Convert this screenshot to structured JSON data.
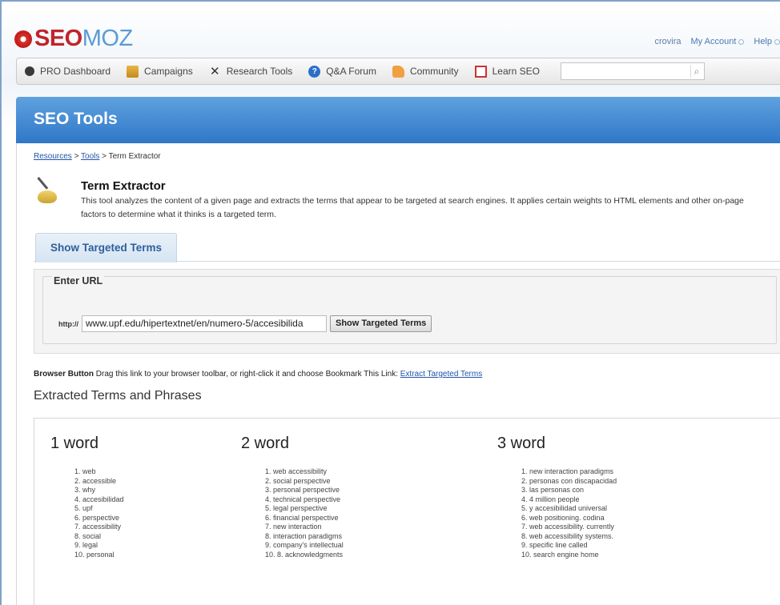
{
  "header": {
    "logo_seo": "SEO",
    "logo_moz": "MOZ",
    "user": "crovira",
    "my_account": "My Account",
    "help": "Help"
  },
  "nav": {
    "items": [
      {
        "label": "PRO Dashboard",
        "icon": "dashboard-icon"
      },
      {
        "label": "Campaigns",
        "icon": "campaigns-icon"
      },
      {
        "label": "Research Tools",
        "icon": "tools-icon"
      },
      {
        "label": "Q&A Forum",
        "icon": "qa-icon"
      },
      {
        "label": "Community",
        "icon": "community-icon"
      },
      {
        "label": "Learn SEO",
        "icon": "learn-icon"
      }
    ],
    "search_value": ""
  },
  "banner": {
    "title": "SEO Tools"
  },
  "breadcrumb": {
    "resources": "Resources",
    "sep1": " > ",
    "tools": "Tools",
    "sep2": " > ",
    "current": "Term Extractor"
  },
  "tool": {
    "title": "Term Extractor",
    "description": "This tool analyzes the content of a given page and extracts the terms that appear to be targeted at search engines. It applies certain weights to HTML elements and other on-page factors to determine what it thinks is a targeted term."
  },
  "tab": {
    "label": "Show Targeted Terms"
  },
  "url_form": {
    "legend": "Enter URL",
    "prefix": "http://",
    "value": "www.upf.edu/hipertextnet/en/numero-5/accesibilida",
    "button": "Show Targeted Terms"
  },
  "browser_button": {
    "bold": "Browser Button",
    "text": " Drag this link to your browser toolbar, or right-click it and choose Bookmark This Link: ",
    "link": "Extract Targeted Terms"
  },
  "extracted_heading": "Extracted Terms and Phrases",
  "columns": [
    {
      "title": "1 word",
      "terms": [
        "1. web",
        "2. accessible",
        "3. why",
        "4. accesibilidad",
        "5. upf",
        "6. perspective",
        "7. accessibility",
        "8. social",
        "9. legal",
        "10. personal"
      ]
    },
    {
      "title": "2 word",
      "terms": [
        "1. web accessibility",
        "2. social perspective",
        "3. personal perspective",
        "4. technical perspective",
        "5. legal perspective",
        "6. financial perspective",
        "7. new interaction",
        "8. interaction paradigms",
        "9. company's intellectual",
        "10. 8. acknowledgments"
      ]
    },
    {
      "title": "3 word",
      "terms": [
        "1. new interaction paradigms",
        "2. personas con discapacidad",
        "3. las personas con",
        "4. 4 million people",
        "5. y accesibilidad universal",
        "6. web positioning. codina",
        "7. web accessibility. currently",
        "8. web accessibility systems.",
        "9. specific line called",
        "10. search engine home"
      ]
    }
  ]
}
